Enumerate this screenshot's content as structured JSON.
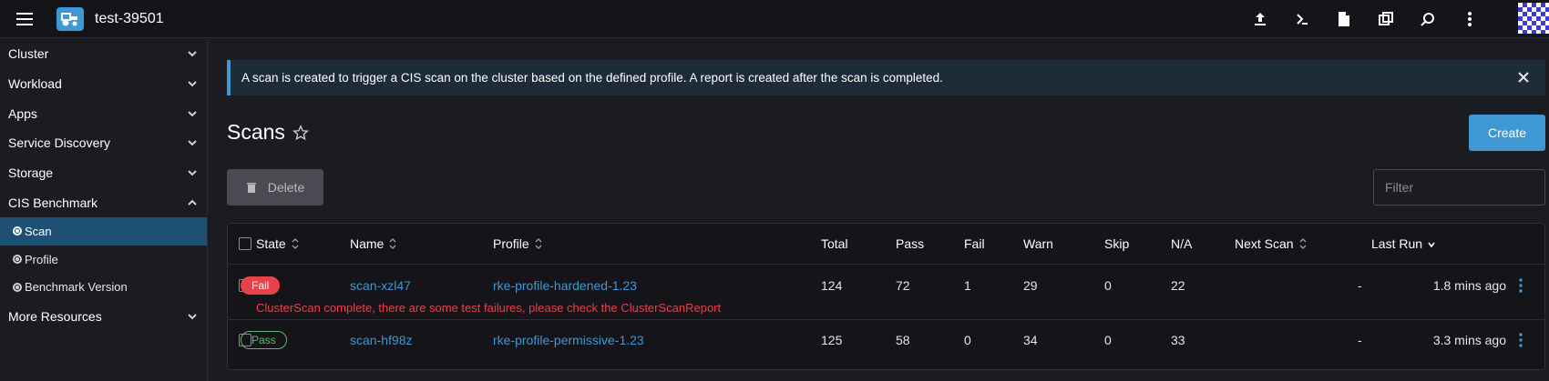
{
  "header": {
    "cluster_name": "test-39501",
    "actions": [
      "upload-icon",
      "terminal-icon",
      "file-icon",
      "copy-icon",
      "search-icon",
      "more-vertical-icon"
    ]
  },
  "sidebar": {
    "groups": [
      {
        "label": "Cluster"
      },
      {
        "label": "Workload"
      },
      {
        "label": "Apps"
      },
      {
        "label": "Service Discovery"
      },
      {
        "label": "Storage"
      },
      {
        "label": "CIS Benchmark",
        "expanded": true,
        "items": [
          "Scan",
          "Profile",
          "Benchmark Version"
        ],
        "active": "Scan"
      },
      {
        "label": "More Resources"
      }
    ]
  },
  "banner": {
    "text": "A scan is created to trigger a CIS scan on the cluster based on the defined profile. A report is created after the scan is completed.",
    "accent": "#3d98d3"
  },
  "page": {
    "title": "Scans",
    "create_label": "Create",
    "delete_label": "Delete",
    "filter_placeholder": "Filter"
  },
  "table": {
    "columns": [
      "State",
      "Name",
      "Profile",
      "Total",
      "Pass",
      "Fail",
      "Warn",
      "Skip",
      "N/A",
      "Next Scan",
      "Last Run"
    ],
    "rows": [
      {
        "state": "Fail",
        "name": "scan-xzl47",
        "profile": "rke-profile-hardened-1.23",
        "total": "124",
        "pass": "72",
        "fail": "1",
        "warn": "29",
        "skip": "0",
        "na": "22",
        "next_scan": "-",
        "last_run": "1.8 mins ago",
        "message": "ClusterScan complete, there are some test failures, please check the ClusterScanReport"
      },
      {
        "state": "Pass",
        "name": "scan-hf98z",
        "profile": "rke-profile-permissive-1.23",
        "total": "125",
        "pass": "58",
        "fail": "0",
        "warn": "34",
        "skip": "0",
        "na": "33",
        "next_scan": "-",
        "last_run": "3.3 mins ago"
      }
    ]
  },
  "colors": {
    "fail": "#e6424c",
    "pass": "#5dbb63",
    "link": "#3d98d3",
    "primary": "#3d98d3"
  }
}
